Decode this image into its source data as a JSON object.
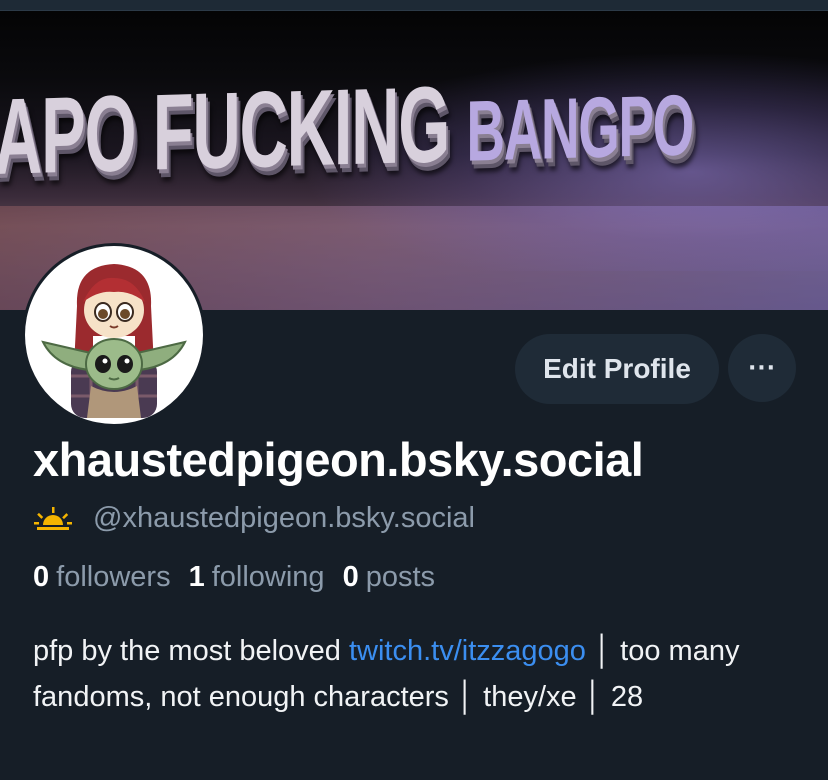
{
  "banner": {
    "text_main": "APO FUCKING ",
    "text_fade": "BANGPO"
  },
  "profile": {
    "display_name": "xhaustedpigeon.bsky.social",
    "handle": "@xhaustedpigeon.bsky.social",
    "handle_icon": "sunrise-icon",
    "edit_label": "Edit Profile",
    "more_label": "···"
  },
  "stats": {
    "followers_count": "0",
    "followers_label": "followers",
    "following_count": "1",
    "following_label": "following",
    "posts_count": "0",
    "posts_label": "posts"
  },
  "bio": {
    "part1": "pfp by the most beloved ",
    "link": "twitch.tv/itzzagogo",
    "part2": " │ too many fandoms, not enough characters │ they/xe │ 28"
  },
  "colors": {
    "background": "#161e27",
    "link": "#3b8ef0",
    "muted": "#8c9bab",
    "button": "#1f2b37"
  }
}
